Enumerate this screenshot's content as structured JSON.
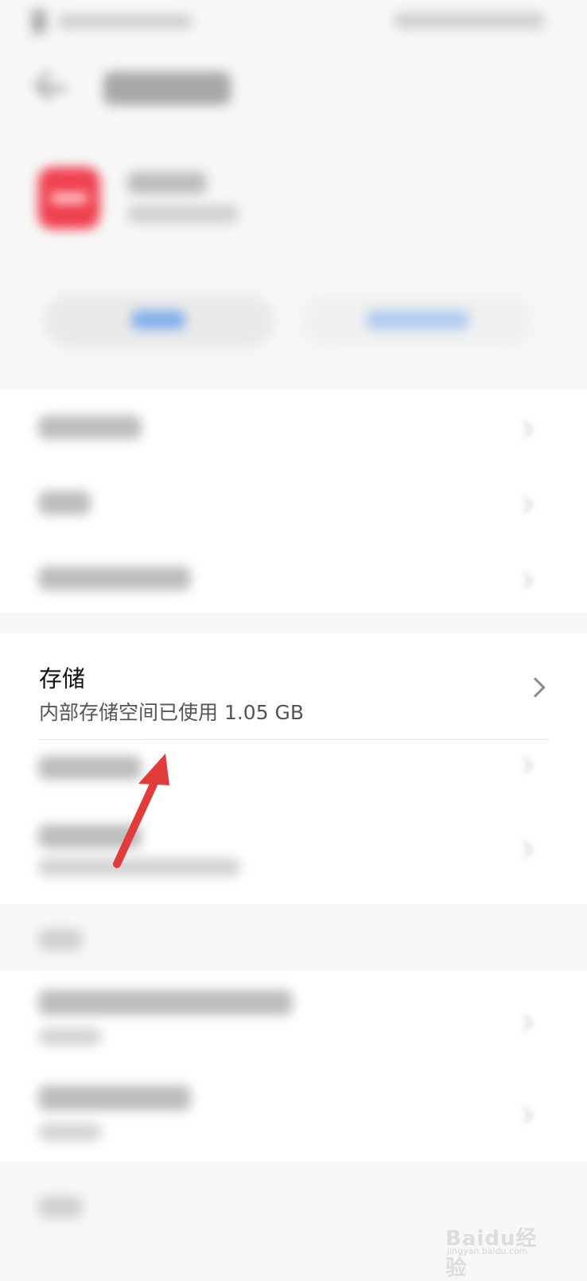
{
  "storage": {
    "title": "存储",
    "subtitle": "内部存储空间已使用 1.05 GB"
  },
  "app": {
    "icon_color": "#f0404f"
  },
  "buttons": {
    "left_accent": "#3d8cf0",
    "right_accent": "#3d8cf0"
  },
  "annotation": {
    "arrow_color": "#e23b3b"
  },
  "watermark": {
    "brand": "Baidu经验",
    "domain": "jingyan.baidu.com"
  },
  "icons": [
    "back-arrow-icon",
    "chevron-right-icon",
    "app-icon",
    "arrow-annotation-icon"
  ]
}
